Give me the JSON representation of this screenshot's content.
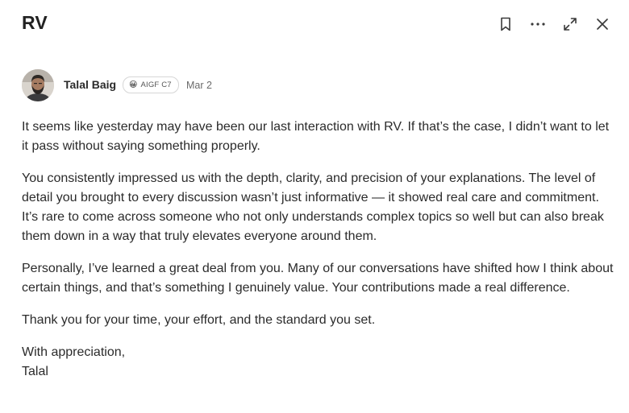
{
  "header": {
    "title": "RV",
    "actions": [
      {
        "name": "bookmark",
        "icon": "bookmark-icon"
      },
      {
        "name": "more",
        "icon": "more-horizontal-icon"
      },
      {
        "name": "expand",
        "icon": "expand-icon"
      },
      {
        "name": "close",
        "icon": "close-icon"
      }
    ]
  },
  "author": {
    "name": "Talal Baig",
    "badge_emoji": "😀",
    "badge_label": "AIGF C7",
    "date": "Mar 2"
  },
  "body": {
    "paragraphs": [
      "It seems like yesterday may have been our last interaction with RV. If that’s the case, I didn’t want to let it pass without saying something properly.",
      "You consistently impressed us with the depth, clarity, and precision of your explanations. The level of detail you brought to every discussion wasn’t just informative — it showed real care and commitment. It’s rare to come across someone who not only understands complex topics so well but can also break them down in a way that truly elevates everyone around them.",
      "Personally, I’ve learned a great deal from you. Many of our conversations have shifted how I think about certain things, and that’s something I genuinely value. Your contributions made a real difference.",
      "Thank you for your time, your effort, and the standard you set."
    ],
    "signoff_line": "With appreciation,",
    "signature": "Talal"
  },
  "colors": {
    "text": "#2b2b2b",
    "muted": "#6b6b6b",
    "icon": "#3a3a3a",
    "badge_border": "#d6d6d6"
  }
}
